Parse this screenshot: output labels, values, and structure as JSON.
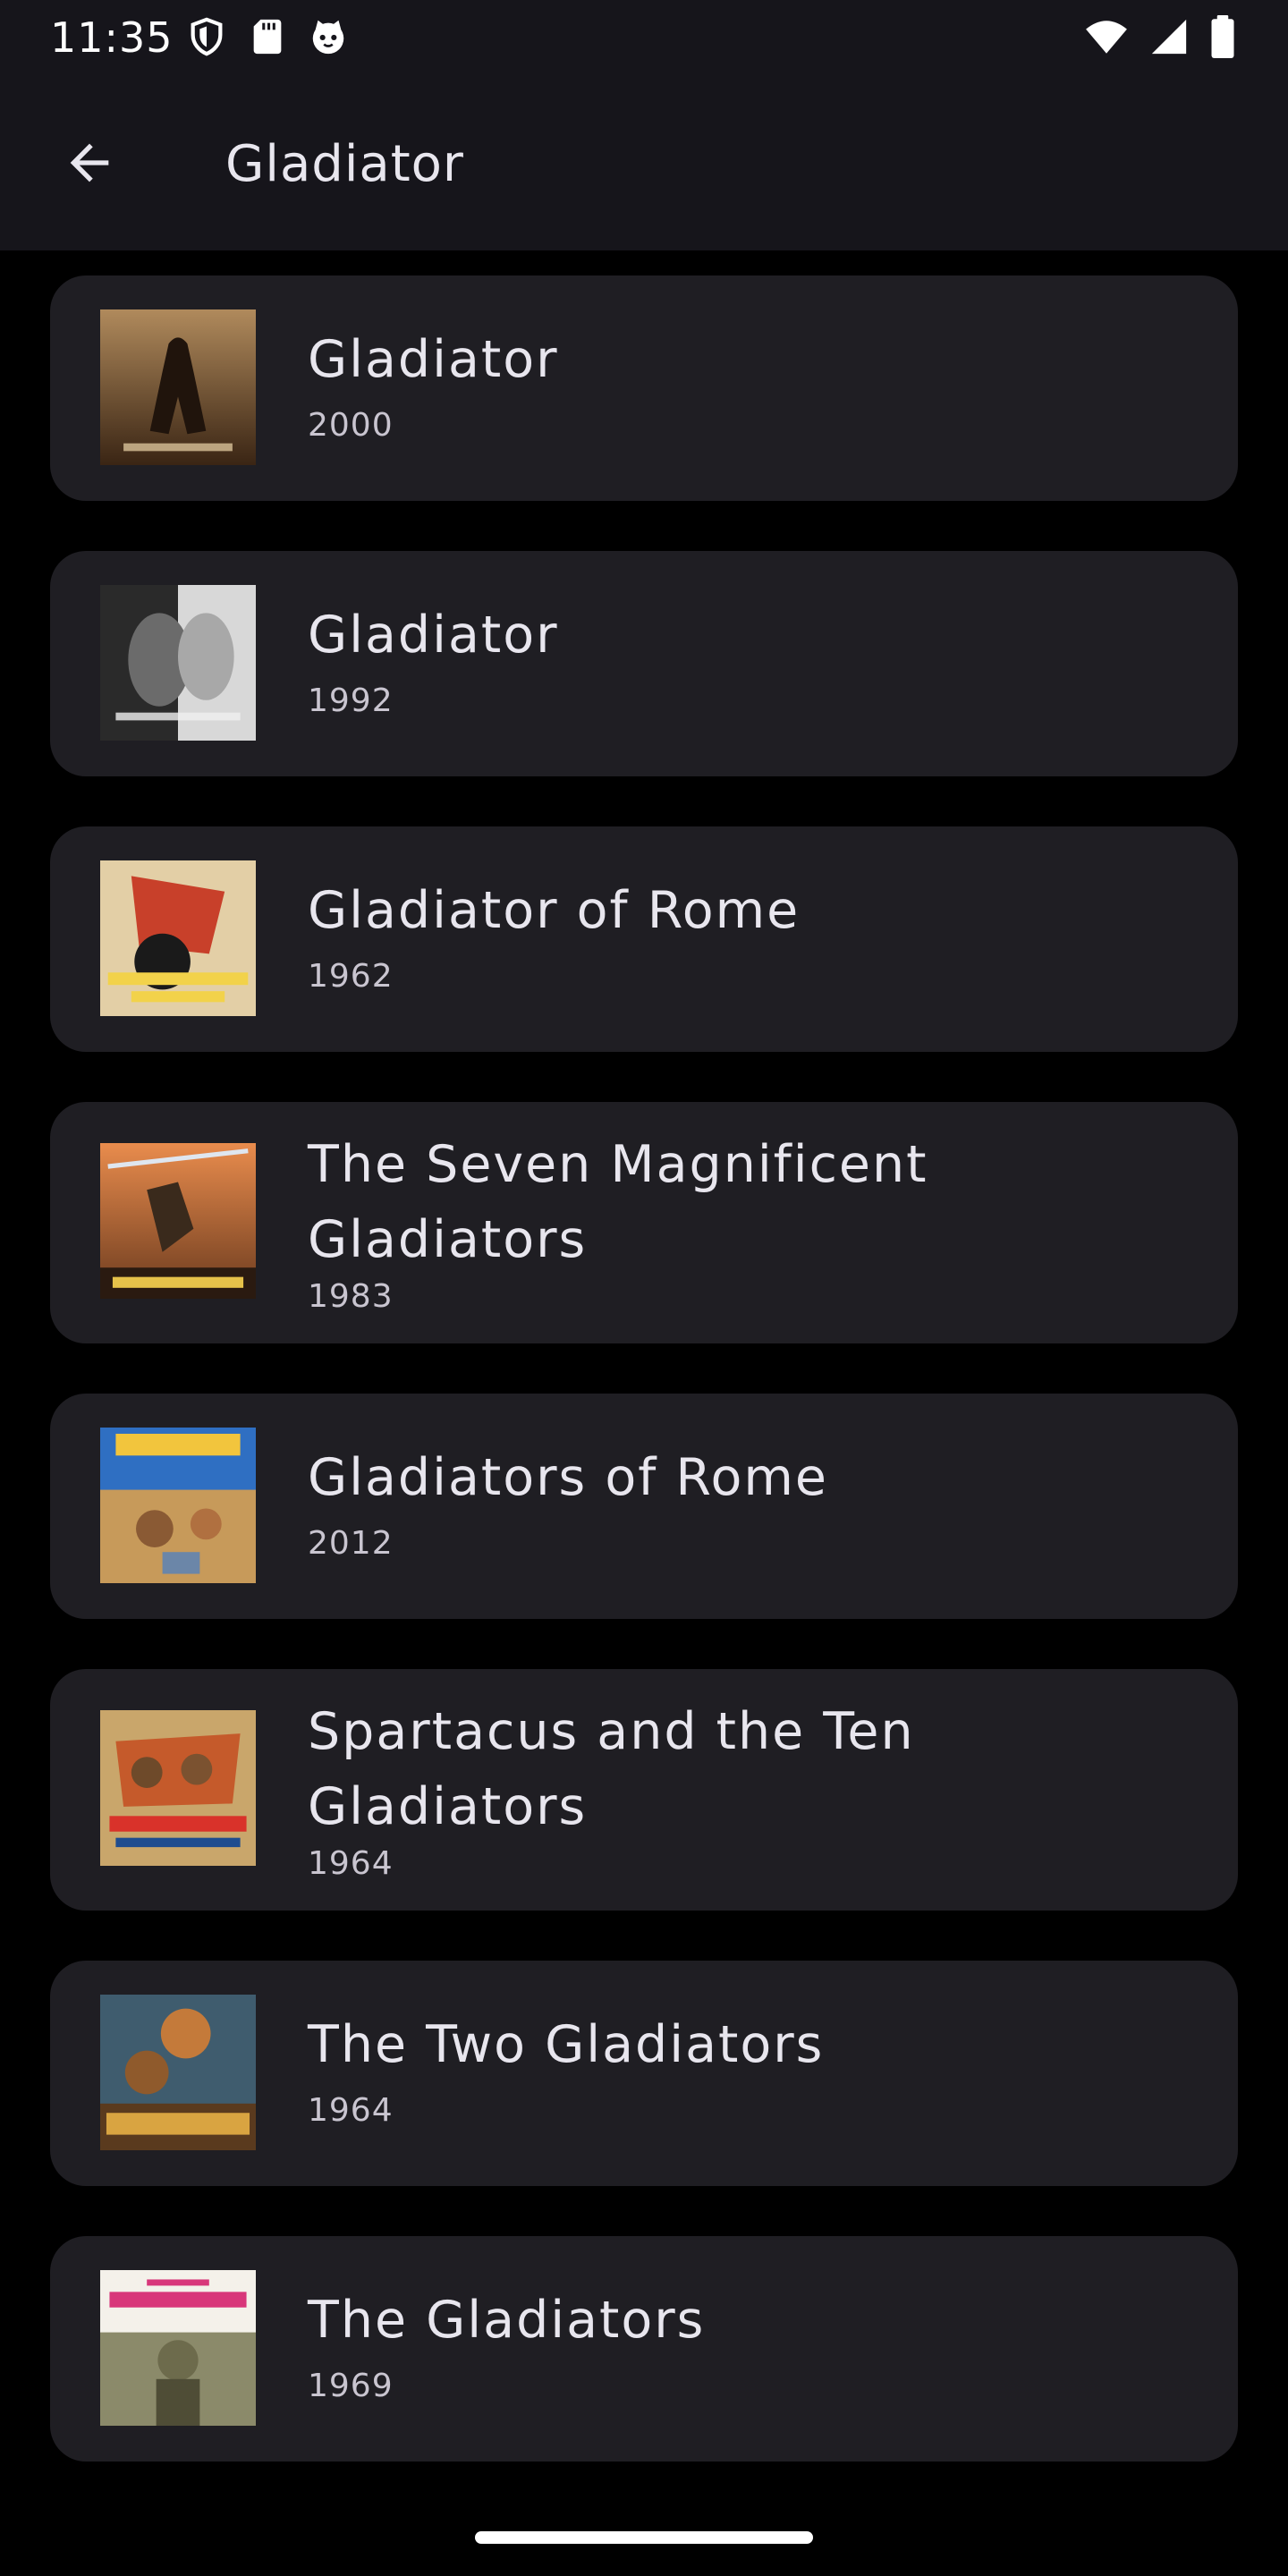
{
  "status_bar": {
    "time": "11:35",
    "left_icons": [
      "shield-icon",
      "sd-card-icon",
      "cat-face-icon"
    ],
    "right_icons": [
      "wifi-icon",
      "cellular-signal-icon",
      "battery-icon"
    ]
  },
  "app_bar": {
    "back_icon": "arrow-back-icon",
    "title": "Gladiator"
  },
  "movies": [
    {
      "title": "Gladiator",
      "year": "2000",
      "poster_icon": "poster-gladiator-2000",
      "poster_colors": [
        "#5a3b22",
        "#b08a5c"
      ]
    },
    {
      "title": "Gladiator",
      "year": "1992",
      "poster_icon": "poster-gladiator-1992",
      "poster_colors": [
        "#1a1a1a",
        "#d8d8d8"
      ]
    },
    {
      "title": "Gladiator of Rome",
      "year": "1962",
      "poster_icon": "poster-gladiator-of-rome",
      "poster_colors": [
        "#e3cfa6",
        "#c8402a"
      ]
    },
    {
      "title": "The Seven Magnificent Gladiators",
      "year": "1983",
      "poster_icon": "poster-seven-magnificent-gladiators",
      "poster_colors": [
        "#d9733c",
        "#3a2a1c"
      ]
    },
    {
      "title": "Gladiators of Rome",
      "year": "2012",
      "poster_icon": "poster-gladiators-of-rome",
      "poster_colors": [
        "#2f6fc2",
        "#c79a5a"
      ]
    },
    {
      "title": "Spartacus and the Ten Gladiators",
      "year": "1964",
      "poster_icon": "poster-spartacus-ten-gladiators",
      "poster_colors": [
        "#c55a2b",
        "#6e4a2a"
      ]
    },
    {
      "title": "The Two Gladiators",
      "year": "1964",
      "poster_icon": "poster-two-gladiators",
      "poster_colors": [
        "#8f5a2c",
        "#d9a441"
      ]
    },
    {
      "title": "The Gladiators",
      "year": "1969",
      "poster_icon": "poster-the-gladiators",
      "poster_colors": [
        "#f4f1ea",
        "#6d6b4c"
      ]
    }
  ],
  "theme": {
    "background": "#000000",
    "bar_background": "#16151b",
    "card_background": "#1f1e23",
    "title_color": "#e8e6ee",
    "subtitle_color": "#c9c5d0"
  }
}
